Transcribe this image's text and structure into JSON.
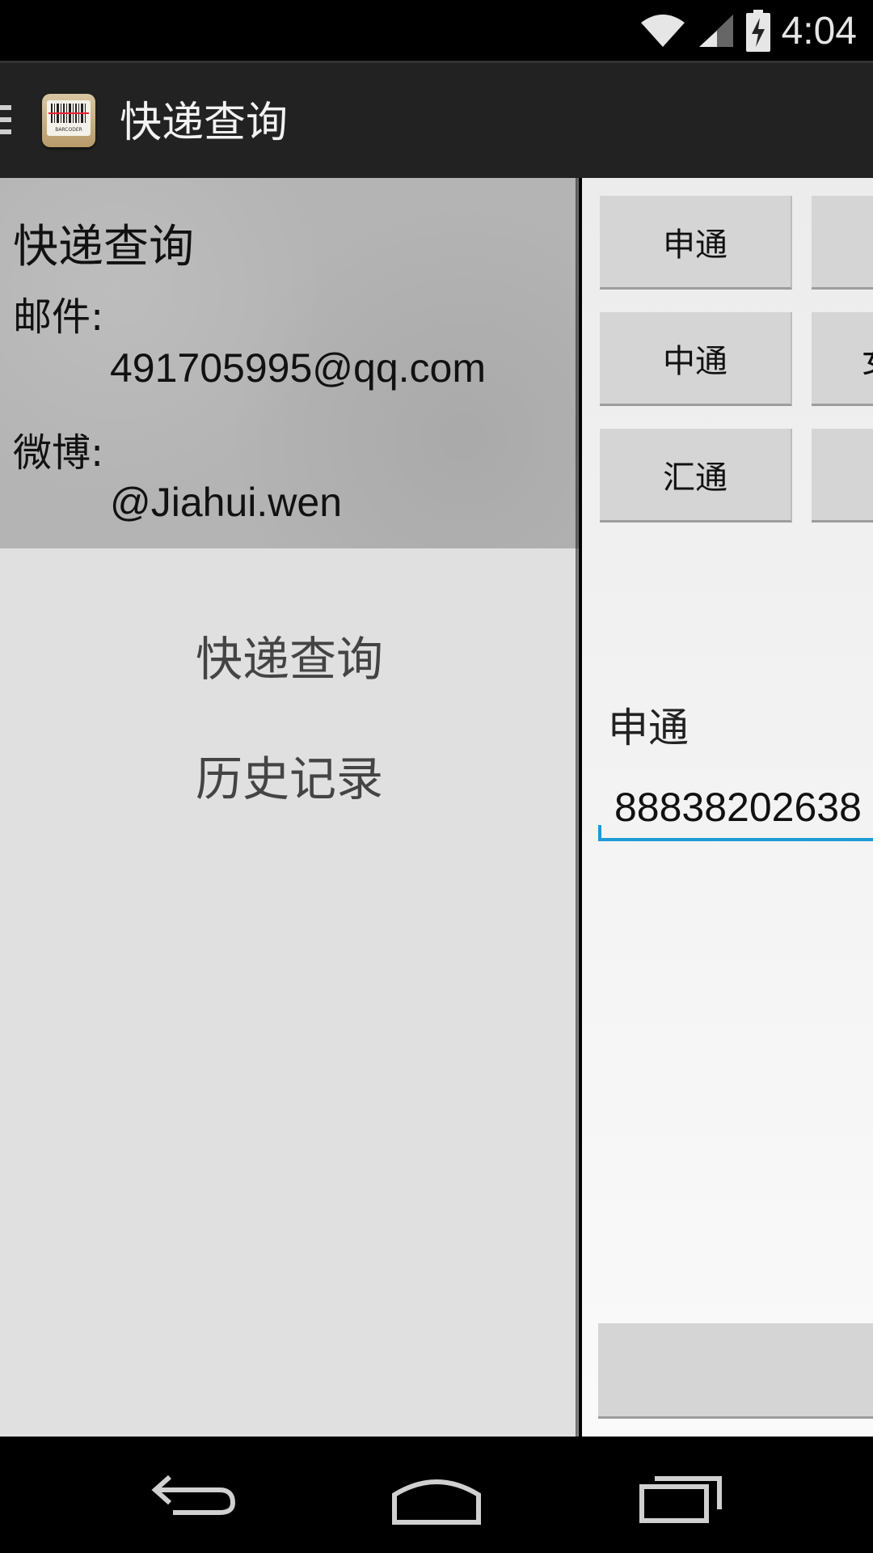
{
  "status_bar": {
    "time": "4:04",
    "icons": [
      "wifi-icon",
      "signal-icon",
      "battery-charging-icon"
    ]
  },
  "action_bar": {
    "title": "快递查询",
    "app_icon": "barcode-app-icon",
    "app_icon_text": "BARCODER"
  },
  "drawer": {
    "header": {
      "title": "快递查询",
      "mail_label": "邮件:",
      "mail_value": "491705995@qq.com",
      "weibo_label": "微博:",
      "weibo_value": "@Jiahui.wen"
    },
    "menu_items": [
      {
        "label": "快递查询"
      },
      {
        "label": "历史记录"
      }
    ]
  },
  "content": {
    "carrier_buttons": [
      {
        "label": "申通"
      },
      {
        "label": "中通"
      },
      {
        "label": "汇通"
      }
    ],
    "partial_button_labels": [
      "",
      "女",
      ""
    ],
    "selected_carrier": "申通",
    "tracking_number": "88838202638"
  },
  "nav_bar": {
    "icons": [
      "back-icon",
      "home-icon",
      "recents-icon"
    ]
  }
}
